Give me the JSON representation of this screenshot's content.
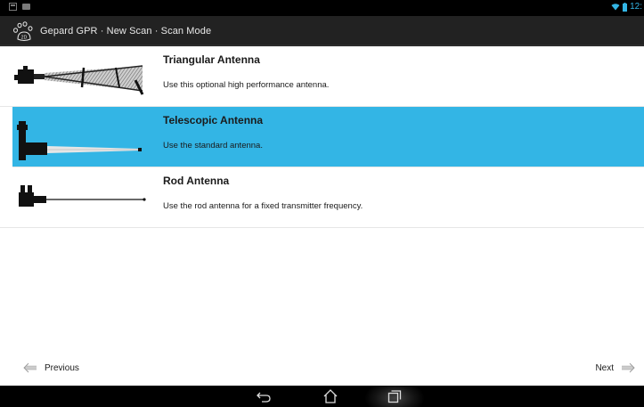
{
  "status_bar": {
    "time": "12:"
  },
  "action_bar": {
    "title": "Gepard GPR · New Scan · Scan Mode",
    "logo_icon": "paw-2d-icon"
  },
  "antennas": [
    {
      "title": "Triangular Antenna",
      "description": "Use this optional high performance antenna.",
      "selected": false,
      "icon": "triangular-antenna-image"
    },
    {
      "title": "Telescopic Antenna",
      "description": "Use the standard antenna.",
      "selected": true,
      "icon": "telescopic-antenna-image"
    },
    {
      "title": "Rod Antenna",
      "description": "Use the rod antenna for a fixed transmitter frequency.",
      "selected": false,
      "icon": "rod-antenna-image"
    }
  ],
  "navigation": {
    "previous_label": "Previous",
    "next_label": "Next"
  },
  "system_nav": {
    "buttons": [
      "back-icon",
      "home-icon",
      "recent-apps-icon"
    ]
  },
  "colors": {
    "selection": "#33b5e5",
    "action_bar": "#222222",
    "status_accent": "#33b5e5"
  }
}
